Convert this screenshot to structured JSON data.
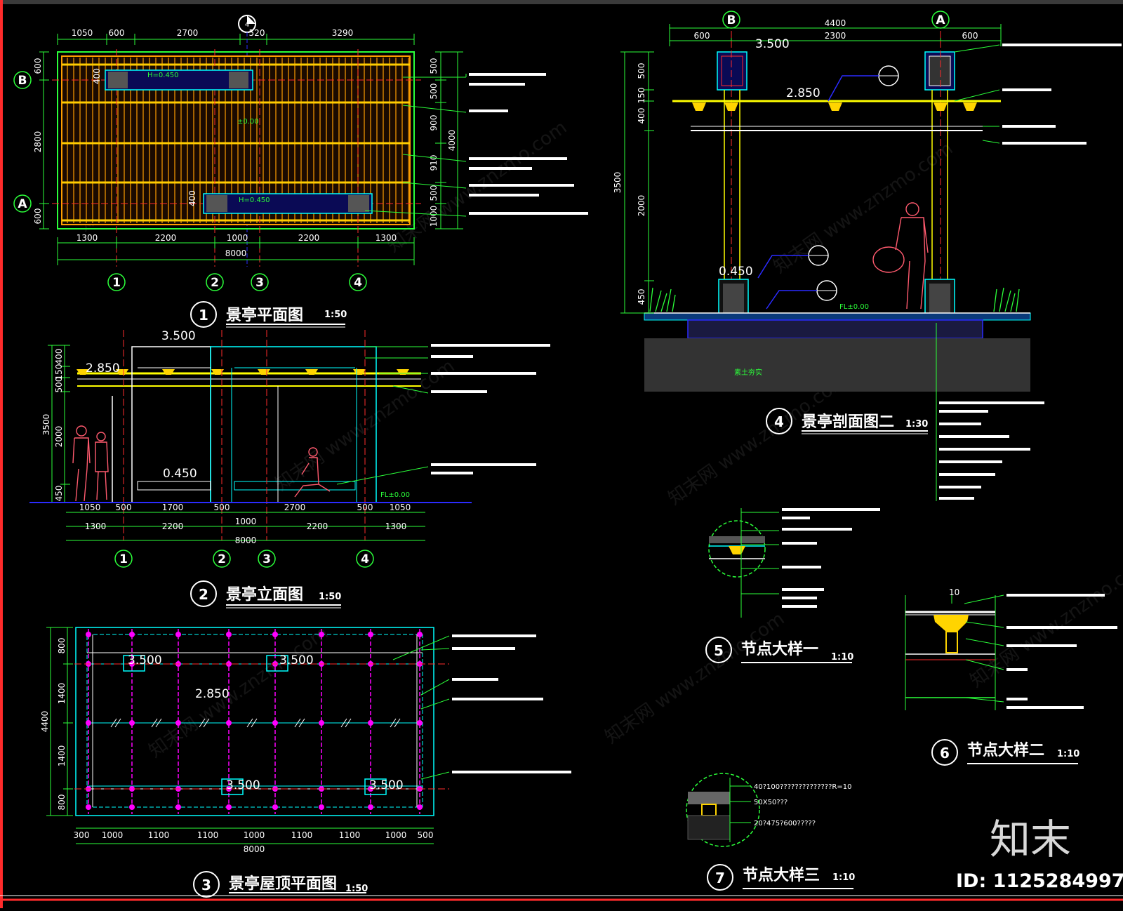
{
  "views": {
    "plan": {
      "num": "1",
      "title": "景亭平面图",
      "scale": "1:50"
    },
    "elevation": {
      "num": "2",
      "title": "景亭立面图",
      "scale": "1:50"
    },
    "roof": {
      "num": "3",
      "title": "景亭屋顶平面图",
      "scale": "1:50"
    },
    "section": {
      "num": "4",
      "title": "景亭剖面图二",
      "scale": "1:30"
    },
    "node1": {
      "num": "5",
      "title": "节点大样一",
      "scale": "1:10"
    },
    "node2": {
      "num": "6",
      "title": "节点大样二",
      "scale": "1:10"
    },
    "node3": {
      "num": "7",
      "title": "节点大样三",
      "scale": "1:10"
    }
  },
  "axes": {
    "a1": "1",
    "a2": "2",
    "a3": "3",
    "a4": "4",
    "aA": "A",
    "aB": "B"
  },
  "plan": {
    "top_dims": [
      "1050",
      "600",
      "2700",
      "520",
      "3290"
    ],
    "bottom_dims": [
      "1300",
      "2200",
      "1000",
      "2200",
      "1300"
    ],
    "total": "8000",
    "left_dims": [
      "600",
      "2800",
      "600"
    ],
    "right_dims": [
      "500",
      "500",
      "900",
      "910",
      "500",
      "1000"
    ],
    "right_total": "4000",
    "bench_h": "400",
    "bench_label": "H=0.450",
    "floor_label": "±0.00",
    "section_mark": "4"
  },
  "elevation": {
    "elev_top": "3.500",
    "elev_mid": "2.850",
    "elev_bench": "0.450",
    "left_dims": [
      "400",
      "150",
      "500",
      "3500",
      "2000",
      "450"
    ],
    "ground_label": "FL±0.00",
    "dims_row1": [
      "1050",
      "500",
      "1700",
      "500",
      "1000",
      "2700",
      "500",
      "1050"
    ],
    "dims_row2": [
      "1300",
      "2200",
      "1000",
      "2200",
      "1300"
    ],
    "total": "8000"
  },
  "roof": {
    "elevs": [
      "3.500",
      "3.500",
      "2.850",
      "3.500",
      "3.500"
    ],
    "left_dims": [
      "800",
      "1400",
      "1400",
      "800"
    ],
    "left_total": "4400",
    "bottom_dims": [
      "300",
      "1000",
      "1100",
      "1100",
      "1000",
      "1100",
      "1100",
      "1000",
      "500"
    ],
    "total": "8000"
  },
  "section": {
    "top_total": "4400",
    "top_dims": [
      "600",
      "2300",
      "600"
    ],
    "elev_top": "3.500",
    "elev_mid": "2.850",
    "elev_bench": "0.450",
    "left_dims": [
      "500",
      "150",
      "400",
      "3500",
      "2000",
      "450"
    ],
    "ground_label": "FL±0.00",
    "base_label": "素土夯实"
  },
  "node3_notes": [
    "40?100??????????????R=10",
    "50X50???",
    "20?475?600?????"
  ],
  "node2_dim": "10",
  "brand": {
    "name": "知末",
    "id": "ID: 1125284997"
  },
  "watermark": "知末网 www.znzmo.com",
  "colors": {
    "cyan": "#00ffff",
    "green": "#2bff3a",
    "yellow": "#ffff00",
    "orange": "#ff9e00",
    "magenta": "#ff00ff",
    "red": "#ff2b2b",
    "white": "#ffffff",
    "blue": "#2b2bff"
  }
}
